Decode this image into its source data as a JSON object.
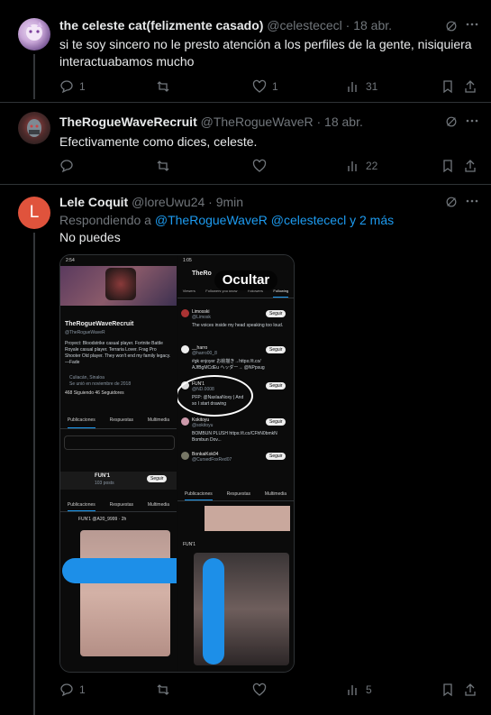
{
  "tweets": [
    {
      "name": "the celeste cat(felizmente casado)",
      "handle": "@celestececl",
      "date": "· 18 abr.",
      "text": "si te soy sincero no le presto atención a los perfiles de la gente, nisiquiera interactuabamos mucho",
      "replies": "1",
      "retweets": "",
      "likes": "1",
      "views": "31"
    },
    {
      "name": "TheRogueWaveRecruit",
      "handle": "@TheRogueWaveR",
      "date": "· 18 abr.",
      "text": "Efectivamente como dices, celeste.",
      "replies": "",
      "retweets": "",
      "likes": "",
      "views": "22"
    },
    {
      "name": "Lele Coquit",
      "handle": "@loreUwu24",
      "date": "· 9min",
      "avatar_letter": "L",
      "reply_prefix": "Respondiendo a",
      "reply_to": "@TheRogueWaveR @celestececl y 2 más",
      "text": "No puedes",
      "replies": "1",
      "retweets": "",
      "likes": "",
      "views": "5"
    }
  ],
  "media": {
    "ocultar_label": "Ocultar",
    "left_time": "2:54",
    "left_profile_name": "TheRogueWaveRecruit",
    "left_profile_handle": "@TheRogueWaveR",
    "left_bio": "Proyect: Bloodstrike casual player. Fortnite Battle Royale casual player. Terraria Lover. Frag Pro Shooter Old player. They won't end my family legacy. —Fade",
    "left_location": "Culiacán, Sinaloa",
    "left_joined": "Se unió en noviembre de 2018",
    "left_following": "468 Siguiendo",
    "left_followers": "46 Seguidores",
    "tabs": [
      "Publicaciones",
      "Respuestas",
      "Multimedia"
    ],
    "profile2_name": "FUN'1",
    "profile2_posts": "103 posts",
    "seguir": "Seguir",
    "right_time": "1:05",
    "right_header": "TheRo",
    "right_tabs": [
      "Viewers",
      "Followers you know",
      "Followers",
      "Following"
    ],
    "follow_list": [
      {
        "name": "Limosski",
        "handle": "@Limosk",
        "bio": "The voices inside my head speaking too loud."
      },
      {
        "name": "__harro",
        "handle": "@harro00_8",
        "bio": "#gk enjoyer お絵描き→https://t.co/ AJfBgMCdEu ヘッダー→ @NPpsug"
      },
      {
        "name": "FUN'1",
        "handle": "@ND.0008",
        "bio": "PFP: @NaxlaaNoxy | And so I start drawing"
      },
      {
        "name": "Kokitoyu",
        "handle": "@sokitoyu",
        "bio": "BOMBUN PLUSH https://t.co/CFhN0bmkN Bombun Dov..."
      },
      {
        "name": "BonkaiKok04",
        "handle": "@CursedFoxRed07",
        "bio": ""
      }
    ],
    "post_author": "FUN'1",
    "post_handle": "@A20_9999 · 2h"
  },
  "colors": {
    "accent": "#1d9bf0",
    "muted": "#71767b",
    "avatar_lele": "#e0533c"
  }
}
